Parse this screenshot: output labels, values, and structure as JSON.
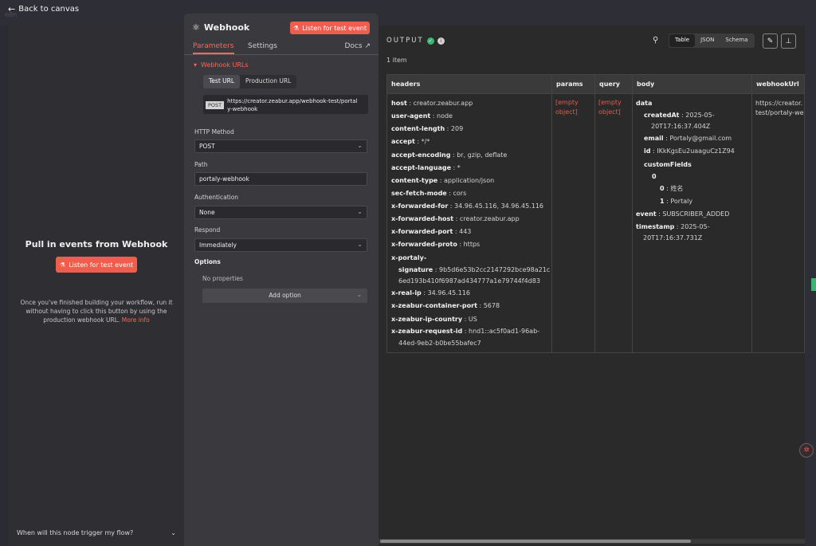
{
  "topbar": {
    "back_label": "Back to canvas",
    "logo_ghost": "n8n"
  },
  "left": {
    "title": "Pull in events from Webhook",
    "listen_label": "Listen for test event",
    "help_text": "Once you've finished building your workflow, run it without having to click this button by using the production webhook URL.",
    "more_info": "More info",
    "footer": "When will this node trigger my flow?"
  },
  "middle": {
    "title": "Webhook",
    "listen_label": "Listen for test event",
    "tabs": {
      "parameters": "Parameters",
      "settings": "Settings",
      "docs": "Docs"
    },
    "section": "Webhook URLs",
    "url_tabs": {
      "test": "Test URL",
      "production": "Production URL"
    },
    "method_badge": "POST",
    "url_line1": "https://creator.zeabur.app/webhook-test/portal",
    "url_line2": "y-webhook",
    "http_method_label": "HTTP Method",
    "http_method_value": "POST",
    "path_label": "Path",
    "path_value": "portaly-webhook",
    "auth_label": "Authentication",
    "auth_value": "None",
    "respond_label": "Respond",
    "respond_value": "Immediately",
    "options_title": "Options",
    "no_props": "No properties",
    "add_option": "Add option"
  },
  "output": {
    "label": "OUTPUT",
    "items_count": "1 item",
    "view_modes": {
      "table": "Table",
      "json": "JSON",
      "schema": "Schema"
    },
    "columns": [
      "headers",
      "params",
      "query",
      "body",
      "webhookUrl"
    ],
    "headers": [
      {
        "k": "host",
        "v": "creator.zeabur.app"
      },
      {
        "k": "user-agent",
        "v": "node"
      },
      {
        "k": "content-length",
        "v": "209"
      },
      {
        "k": "accept",
        "v": "*/*"
      },
      {
        "k": "accept-encoding",
        "v": "br, gzip, deflate"
      },
      {
        "k": "accept-language",
        "v": "*"
      },
      {
        "k": "content-type",
        "v": "application/json"
      },
      {
        "k": "sec-fetch-mode",
        "v": "cors"
      },
      {
        "k": "x-forwarded-for",
        "v": "34.96.45.116, 34.96.45.116"
      },
      {
        "k": "x-forwarded-host",
        "v": "creator.zeabur.app"
      },
      {
        "k": "x-forwarded-port",
        "v": "443"
      },
      {
        "k": "x-forwarded-proto",
        "v": "https"
      }
    ],
    "signature_key1": "x-portaly-",
    "signature_key2": "signature",
    "signature_v1": "9b5d6e53b2cc2147292bce98a21c",
    "signature_v2": "6ed193b410f6987ad434777a1e79744f4d83",
    "headers_tail": [
      {
        "k": "x-real-ip",
        "v": "34.96.45.116"
      },
      {
        "k": "x-zeabur-container-port",
        "v": "5678"
      },
      {
        "k": "x-zeabur-ip-country",
        "v": "US"
      }
    ],
    "request_id_key": "x-zeabur-request-id",
    "request_id_v1": "hnd1::ac5f0ad1-96ab-",
    "request_id_v2": "44ed-9eb2-b0be55bafec7",
    "params_l1": "[empty",
    "params_l2": "object]",
    "query_l1": "[empty",
    "query_l2": "object]",
    "body": {
      "data": "data",
      "createdAt_k": "createdAt",
      "createdAt_v1": "2025-05-",
      "createdAt_v2": "20T17:16:37.404Z",
      "email_k": "email",
      "email_v": "Portaly@gmail.com",
      "id_k": "id",
      "id_v": "IKkKgsEu2uaaguCz1Z94",
      "customFields": "customFields",
      "idx0": "0",
      "sub0_k": "0",
      "sub0_v": "姓名",
      "sub1_k": "1",
      "sub1_v": "Portaly",
      "event_k": "event",
      "event_v": "SUBSCRIBER_ADDED",
      "timestamp_k": "timestamp",
      "timestamp_v1": "2025-05-",
      "timestamp_v2": "20T17:16:37.731Z"
    },
    "webhook_l1": "https://creator.",
    "webhook_l2": "test/portaly-web"
  }
}
